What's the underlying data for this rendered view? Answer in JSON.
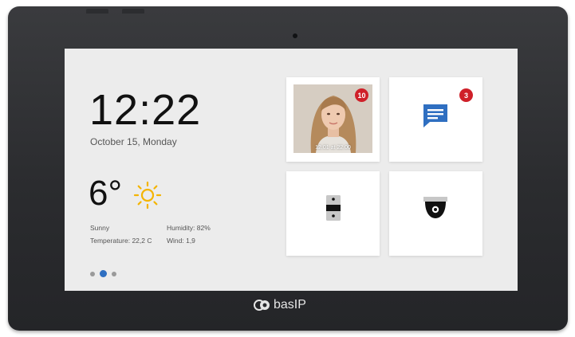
{
  "home": {
    "time": "12:22",
    "date": "October 15, Monday",
    "temperature": "6°",
    "weather_icon": "sun-icon",
    "condition": "Sunny",
    "humidity": "Humidity: 82%",
    "temperature_detail": "Temperature: 22,2 C",
    "wind": "Wind: 1,9"
  },
  "tiles": {
    "visitor": {
      "badge": "10",
      "caption": "12.01 at 22.00"
    },
    "messages": {
      "badge": "3",
      "icon": "message-icon"
    },
    "lock": {
      "icon": "door-lock-icon"
    },
    "camera": {
      "icon": "dome-camera-icon"
    }
  },
  "pager": {
    "count": 3,
    "active": 2
  },
  "device": {
    "brand": "basIP"
  },
  "colors": {
    "accent": "#2f6fc1",
    "badge": "#cf2029",
    "sun": "#f4b400"
  }
}
